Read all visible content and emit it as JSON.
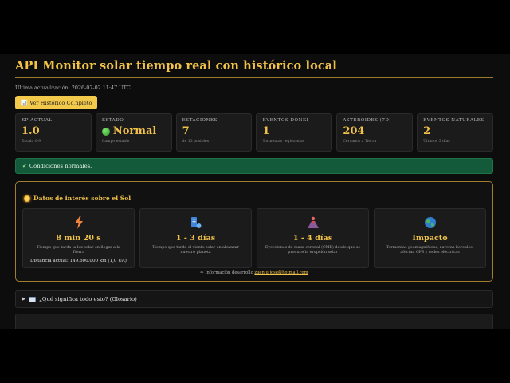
{
  "header": {
    "title": "API Monitor solar tiempo real con histórico local",
    "last_update": "Última actualización: 2026-07-02 11:47 UTC"
  },
  "toolbar": {
    "history_button_icon": "📊",
    "history_button_label": "Ver Histórico Cc,npleto"
  },
  "stats": [
    {
      "label": "KP ACTUAL",
      "value": "1.0",
      "sub": "Escala 0-9"
    },
    {
      "label": "ESTADO",
      "value": "Normal",
      "sub": "Campo estable",
      "icon": "green-status-dot"
    },
    {
      "label": "ESTACIONES",
      "value": "7",
      "sub": "de 13 posibles"
    },
    {
      "label": "EVENTOS DONKI",
      "value": "1",
      "sub": "Tormentas registradas"
    },
    {
      "label": "ASTEROIDES (7D)",
      "value": "204",
      "sub": "Cercanos a Tierra"
    },
    {
      "label": "EVENTOS NATURALES",
      "value": "2",
      "sub": "Últimos 5 días"
    }
  ],
  "alert": {
    "icon": "✔",
    "text": "Condiciones normales."
  },
  "sun_panel": {
    "title": "Datos de interés sobre el Sol",
    "cards": [
      {
        "icon": "lightning-icon",
        "value": "8 min 20 s",
        "desc": "Tiempo que tarda la luz solar en llegar a la Tierra",
        "extra": "Distancia actual: 149.600.000 km (1,0 UA)"
      },
      {
        "icon": "wind-icon",
        "value": "1 - 3 días",
        "desc": "Tiempo que tarda el viento solar en alcanzar nuestro planeta",
        "extra": ""
      },
      {
        "icon": "volcano-icon",
        "value": "1 - 4 días",
        "desc": "Eyecciones de masa coronal (CME) desde que se produce la erupción solar",
        "extra": ""
      },
      {
        "icon": "globe-icon",
        "value": "Impacto",
        "desc": "Tormentas geomagnéticas, auroras boreales, afectan GPS y redes eléctricas",
        "extra": ""
      }
    ],
    "contact_icon": "✏",
    "contact_label": "Información desarrollo",
    "contact_email": "zuenju.jose@hotmail.com"
  },
  "glossary": {
    "toggle": "▶",
    "label": "¿Qué significa todo esto? (Glosario)"
  },
  "colors": {
    "accent": "#f0c24a",
    "background": "#0d0d0d",
    "card": "#1b1b1b",
    "alert_bg": "#135a3a",
    "button_bg": "#f3c94b"
  }
}
